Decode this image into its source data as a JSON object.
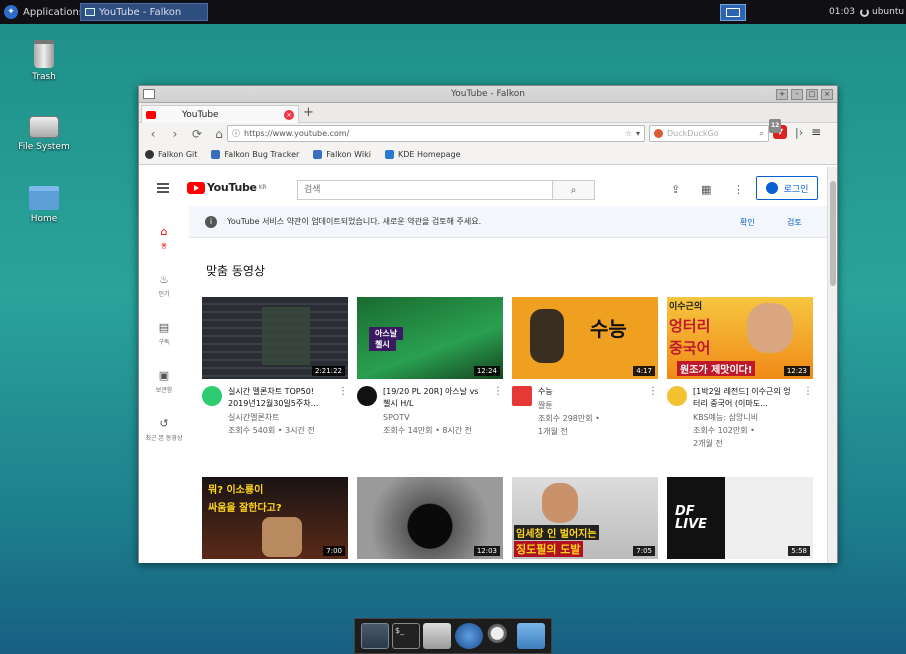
{
  "topbar": {
    "applications_label": "Applications",
    "task_title": "YouTube - Falkon",
    "clock": "01:03",
    "user": "ubuntu"
  },
  "desktop": {
    "icons": [
      {
        "label": "Trash"
      },
      {
        "label": "File System"
      },
      {
        "label": "Home"
      }
    ]
  },
  "browser": {
    "window_title": "YouTube - Falkon",
    "tab_title": "YouTube",
    "url": "https://www.youtube.com/",
    "search_placeholder": "DuckDuckGo",
    "adblock_count": "12",
    "bookmarks": [
      "Falkon Git",
      "Falkon Bug Tracker",
      "Falkon Wiki",
      "KDE Homepage"
    ]
  },
  "youtube": {
    "logo_text": "YouTube",
    "region": "KR",
    "search_placeholder": "검색",
    "signin_label": "로그인",
    "sidebar": [
      "홈",
      "인기",
      "구독",
      "보관함",
      "최근 본 동영상"
    ],
    "notice": {
      "text": "YouTube 서비스 약관이 업데이트되었습니다. 새로운 약관을 검토해 주세요.",
      "confirm": "확인",
      "review": "검토"
    },
    "section_title": "맞춤 동영상",
    "videos": [
      {
        "duration": "2:21:22",
        "title": "실시간 멜론차트 TOP50! 2019년12월30일5주차...",
        "channel": "실시간멜론차트",
        "stats": "조회수 540회 • 3시간 전",
        "ch_color": "#2ecc71",
        "thumb_color": "#2a2d33"
      },
      {
        "duration": "12:24",
        "title": "[19/20 PL 20R] 아스날 vs 첼시 H/L",
        "channel": "SPOTV",
        "stats": "조회수 14만회 • 8시간 전",
        "ch_color": "#111111",
        "thumb_color": "#1d7a3a"
      },
      {
        "duration": "4:17",
        "title": "수능",
        "channel": "짤툰",
        "stats": "조회수 298만회 •",
        "stats2": "1개월 전",
        "ch_color": "#e53935",
        "thumb_color": "#f0a020"
      },
      {
        "duration": "12:23",
        "title": "[1박2일 레전드] 이수근의 엉터리 중국어 (이마도...",
        "channel": "KBS예능: 삼앙니비",
        "stats": "조회수 102만회 •",
        "stats2": "2개월 전",
        "ch_color": "#f2c230",
        "thumb_color": "#f08a18"
      },
      {
        "duration": "7:00",
        "title": "",
        "thumb_color": "#3a2a22"
      },
      {
        "duration": "12:03",
        "title": "",
        "thumb_color": "#6a6a6a"
      },
      {
        "duration": "7:05",
        "title": "",
        "thumb_color": "#d8d8d8"
      },
      {
        "duration": "5:58",
        "title": "",
        "thumb_color": "#e9e9e9"
      }
    ],
    "thumb_text": {
      "t3": "수능",
      "t4a": "이수근의",
      "t4b": "엉터리",
      "t4c": "중국어",
      "t4d": "원조가 제맛이다!",
      "t5a": "뭐? 이소룡이",
      "t5b": "싸움을 잘한다고?",
      "t7a": "임세창 인 벌어지는",
      "t7b": "징도필의 도발",
      "t8": "DF LIVE",
      "t2a": "아스날",
      "t2b": "첼시"
    }
  }
}
